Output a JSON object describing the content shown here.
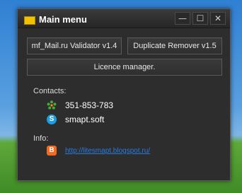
{
  "window": {
    "title": "Main menu",
    "controls": {
      "minimize": "—",
      "maximize": "☐",
      "close": "✕"
    }
  },
  "buttons": {
    "validator": "mf_Mail.ru Validator v1.4",
    "remover": "Duplicate Remover v1.5",
    "licence": "Licence manager."
  },
  "contacts": {
    "label": "Contacts:",
    "icq": {
      "icon": "icq-flower-icon",
      "value": "351-853-783"
    },
    "skype": {
      "icon": "skype-icon",
      "value": "smapt.soft"
    }
  },
  "info": {
    "label": "Info:",
    "blog": {
      "icon": "blogger-icon",
      "link": "http://litesmapt.blogspot.ru/"
    }
  },
  "colors": {
    "window_bg": "#2d2d2d",
    "title_icon": "#f2c200",
    "link": "#2a7be0",
    "skype": "#1e9de0",
    "blogger": "#f26b22"
  }
}
